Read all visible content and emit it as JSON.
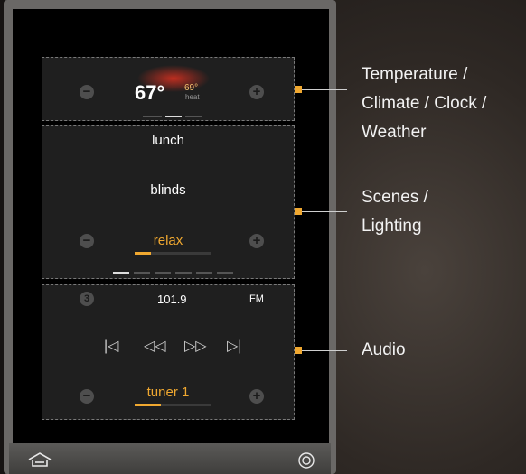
{
  "temperature": {
    "current": "67°",
    "setpoint": "69°",
    "mode": "heat",
    "page_dots": [
      false,
      false,
      true,
      false
    ]
  },
  "scenes": {
    "items": [
      "lunch",
      "blinds",
      "relax"
    ],
    "selected": "relax",
    "level": 0.22,
    "page_dots": [
      true,
      false,
      false,
      false,
      false,
      false
    ]
  },
  "audio": {
    "room_number": "3",
    "station": "101.9",
    "band": "FM",
    "source": "tuner 1",
    "volume": 0.35,
    "controls": [
      "skip-back-icon",
      "rewind-icon",
      "fast-forward-icon",
      "skip-forward-icon"
    ]
  },
  "bottom_bar": {
    "left_icon": "home-icon",
    "right_icon": "power-icon"
  },
  "callouts": {
    "temperature": "Temperature / Climate / Clock / Weather",
    "scenes": "Scenes / Lighting",
    "audio": "Audio"
  },
  "colors": {
    "accent": "#f0a830",
    "label": "#f2f2f2"
  }
}
